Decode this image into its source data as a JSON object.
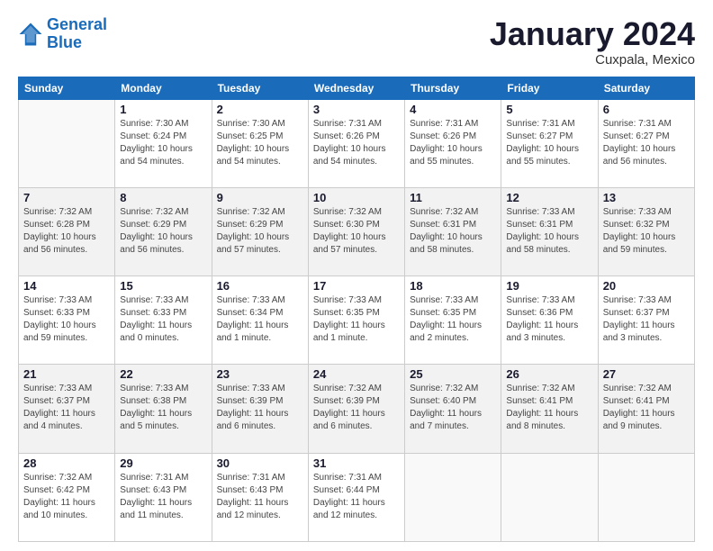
{
  "header": {
    "logo_line1": "General",
    "logo_line2": "Blue",
    "title": "January 2024",
    "subtitle": "Cuxpala, Mexico"
  },
  "columns": [
    "Sunday",
    "Monday",
    "Tuesday",
    "Wednesday",
    "Thursday",
    "Friday",
    "Saturday"
  ],
  "weeks": [
    [
      {
        "num": "",
        "info": ""
      },
      {
        "num": "1",
        "info": "Sunrise: 7:30 AM\nSunset: 6:24 PM\nDaylight: 10 hours\nand 54 minutes."
      },
      {
        "num": "2",
        "info": "Sunrise: 7:30 AM\nSunset: 6:25 PM\nDaylight: 10 hours\nand 54 minutes."
      },
      {
        "num": "3",
        "info": "Sunrise: 7:31 AM\nSunset: 6:26 PM\nDaylight: 10 hours\nand 54 minutes."
      },
      {
        "num": "4",
        "info": "Sunrise: 7:31 AM\nSunset: 6:26 PM\nDaylight: 10 hours\nand 55 minutes."
      },
      {
        "num": "5",
        "info": "Sunrise: 7:31 AM\nSunset: 6:27 PM\nDaylight: 10 hours\nand 55 minutes."
      },
      {
        "num": "6",
        "info": "Sunrise: 7:31 AM\nSunset: 6:27 PM\nDaylight: 10 hours\nand 56 minutes."
      }
    ],
    [
      {
        "num": "7",
        "info": "Sunrise: 7:32 AM\nSunset: 6:28 PM\nDaylight: 10 hours\nand 56 minutes."
      },
      {
        "num": "8",
        "info": "Sunrise: 7:32 AM\nSunset: 6:29 PM\nDaylight: 10 hours\nand 56 minutes."
      },
      {
        "num": "9",
        "info": "Sunrise: 7:32 AM\nSunset: 6:29 PM\nDaylight: 10 hours\nand 57 minutes."
      },
      {
        "num": "10",
        "info": "Sunrise: 7:32 AM\nSunset: 6:30 PM\nDaylight: 10 hours\nand 57 minutes."
      },
      {
        "num": "11",
        "info": "Sunrise: 7:32 AM\nSunset: 6:31 PM\nDaylight: 10 hours\nand 58 minutes."
      },
      {
        "num": "12",
        "info": "Sunrise: 7:33 AM\nSunset: 6:31 PM\nDaylight: 10 hours\nand 58 minutes."
      },
      {
        "num": "13",
        "info": "Sunrise: 7:33 AM\nSunset: 6:32 PM\nDaylight: 10 hours\nand 59 minutes."
      }
    ],
    [
      {
        "num": "14",
        "info": "Sunrise: 7:33 AM\nSunset: 6:33 PM\nDaylight: 10 hours\nand 59 minutes."
      },
      {
        "num": "15",
        "info": "Sunrise: 7:33 AM\nSunset: 6:33 PM\nDaylight: 11 hours\nand 0 minutes."
      },
      {
        "num": "16",
        "info": "Sunrise: 7:33 AM\nSunset: 6:34 PM\nDaylight: 11 hours\nand 1 minute."
      },
      {
        "num": "17",
        "info": "Sunrise: 7:33 AM\nSunset: 6:35 PM\nDaylight: 11 hours\nand 1 minute."
      },
      {
        "num": "18",
        "info": "Sunrise: 7:33 AM\nSunset: 6:35 PM\nDaylight: 11 hours\nand 2 minutes."
      },
      {
        "num": "19",
        "info": "Sunrise: 7:33 AM\nSunset: 6:36 PM\nDaylight: 11 hours\nand 3 minutes."
      },
      {
        "num": "20",
        "info": "Sunrise: 7:33 AM\nSunset: 6:37 PM\nDaylight: 11 hours\nand 3 minutes."
      }
    ],
    [
      {
        "num": "21",
        "info": "Sunrise: 7:33 AM\nSunset: 6:37 PM\nDaylight: 11 hours\nand 4 minutes."
      },
      {
        "num": "22",
        "info": "Sunrise: 7:33 AM\nSunset: 6:38 PM\nDaylight: 11 hours\nand 5 minutes."
      },
      {
        "num": "23",
        "info": "Sunrise: 7:33 AM\nSunset: 6:39 PM\nDaylight: 11 hours\nand 6 minutes."
      },
      {
        "num": "24",
        "info": "Sunrise: 7:32 AM\nSunset: 6:39 PM\nDaylight: 11 hours\nand 6 minutes."
      },
      {
        "num": "25",
        "info": "Sunrise: 7:32 AM\nSunset: 6:40 PM\nDaylight: 11 hours\nand 7 minutes."
      },
      {
        "num": "26",
        "info": "Sunrise: 7:32 AM\nSunset: 6:41 PM\nDaylight: 11 hours\nand 8 minutes."
      },
      {
        "num": "27",
        "info": "Sunrise: 7:32 AM\nSunset: 6:41 PM\nDaylight: 11 hours\nand 9 minutes."
      }
    ],
    [
      {
        "num": "28",
        "info": "Sunrise: 7:32 AM\nSunset: 6:42 PM\nDaylight: 11 hours\nand 10 minutes."
      },
      {
        "num": "29",
        "info": "Sunrise: 7:31 AM\nSunset: 6:43 PM\nDaylight: 11 hours\nand 11 minutes."
      },
      {
        "num": "30",
        "info": "Sunrise: 7:31 AM\nSunset: 6:43 PM\nDaylight: 11 hours\nand 12 minutes."
      },
      {
        "num": "31",
        "info": "Sunrise: 7:31 AM\nSunset: 6:44 PM\nDaylight: 11 hours\nand 12 minutes."
      },
      {
        "num": "",
        "info": ""
      },
      {
        "num": "",
        "info": ""
      },
      {
        "num": "",
        "info": ""
      }
    ]
  ]
}
